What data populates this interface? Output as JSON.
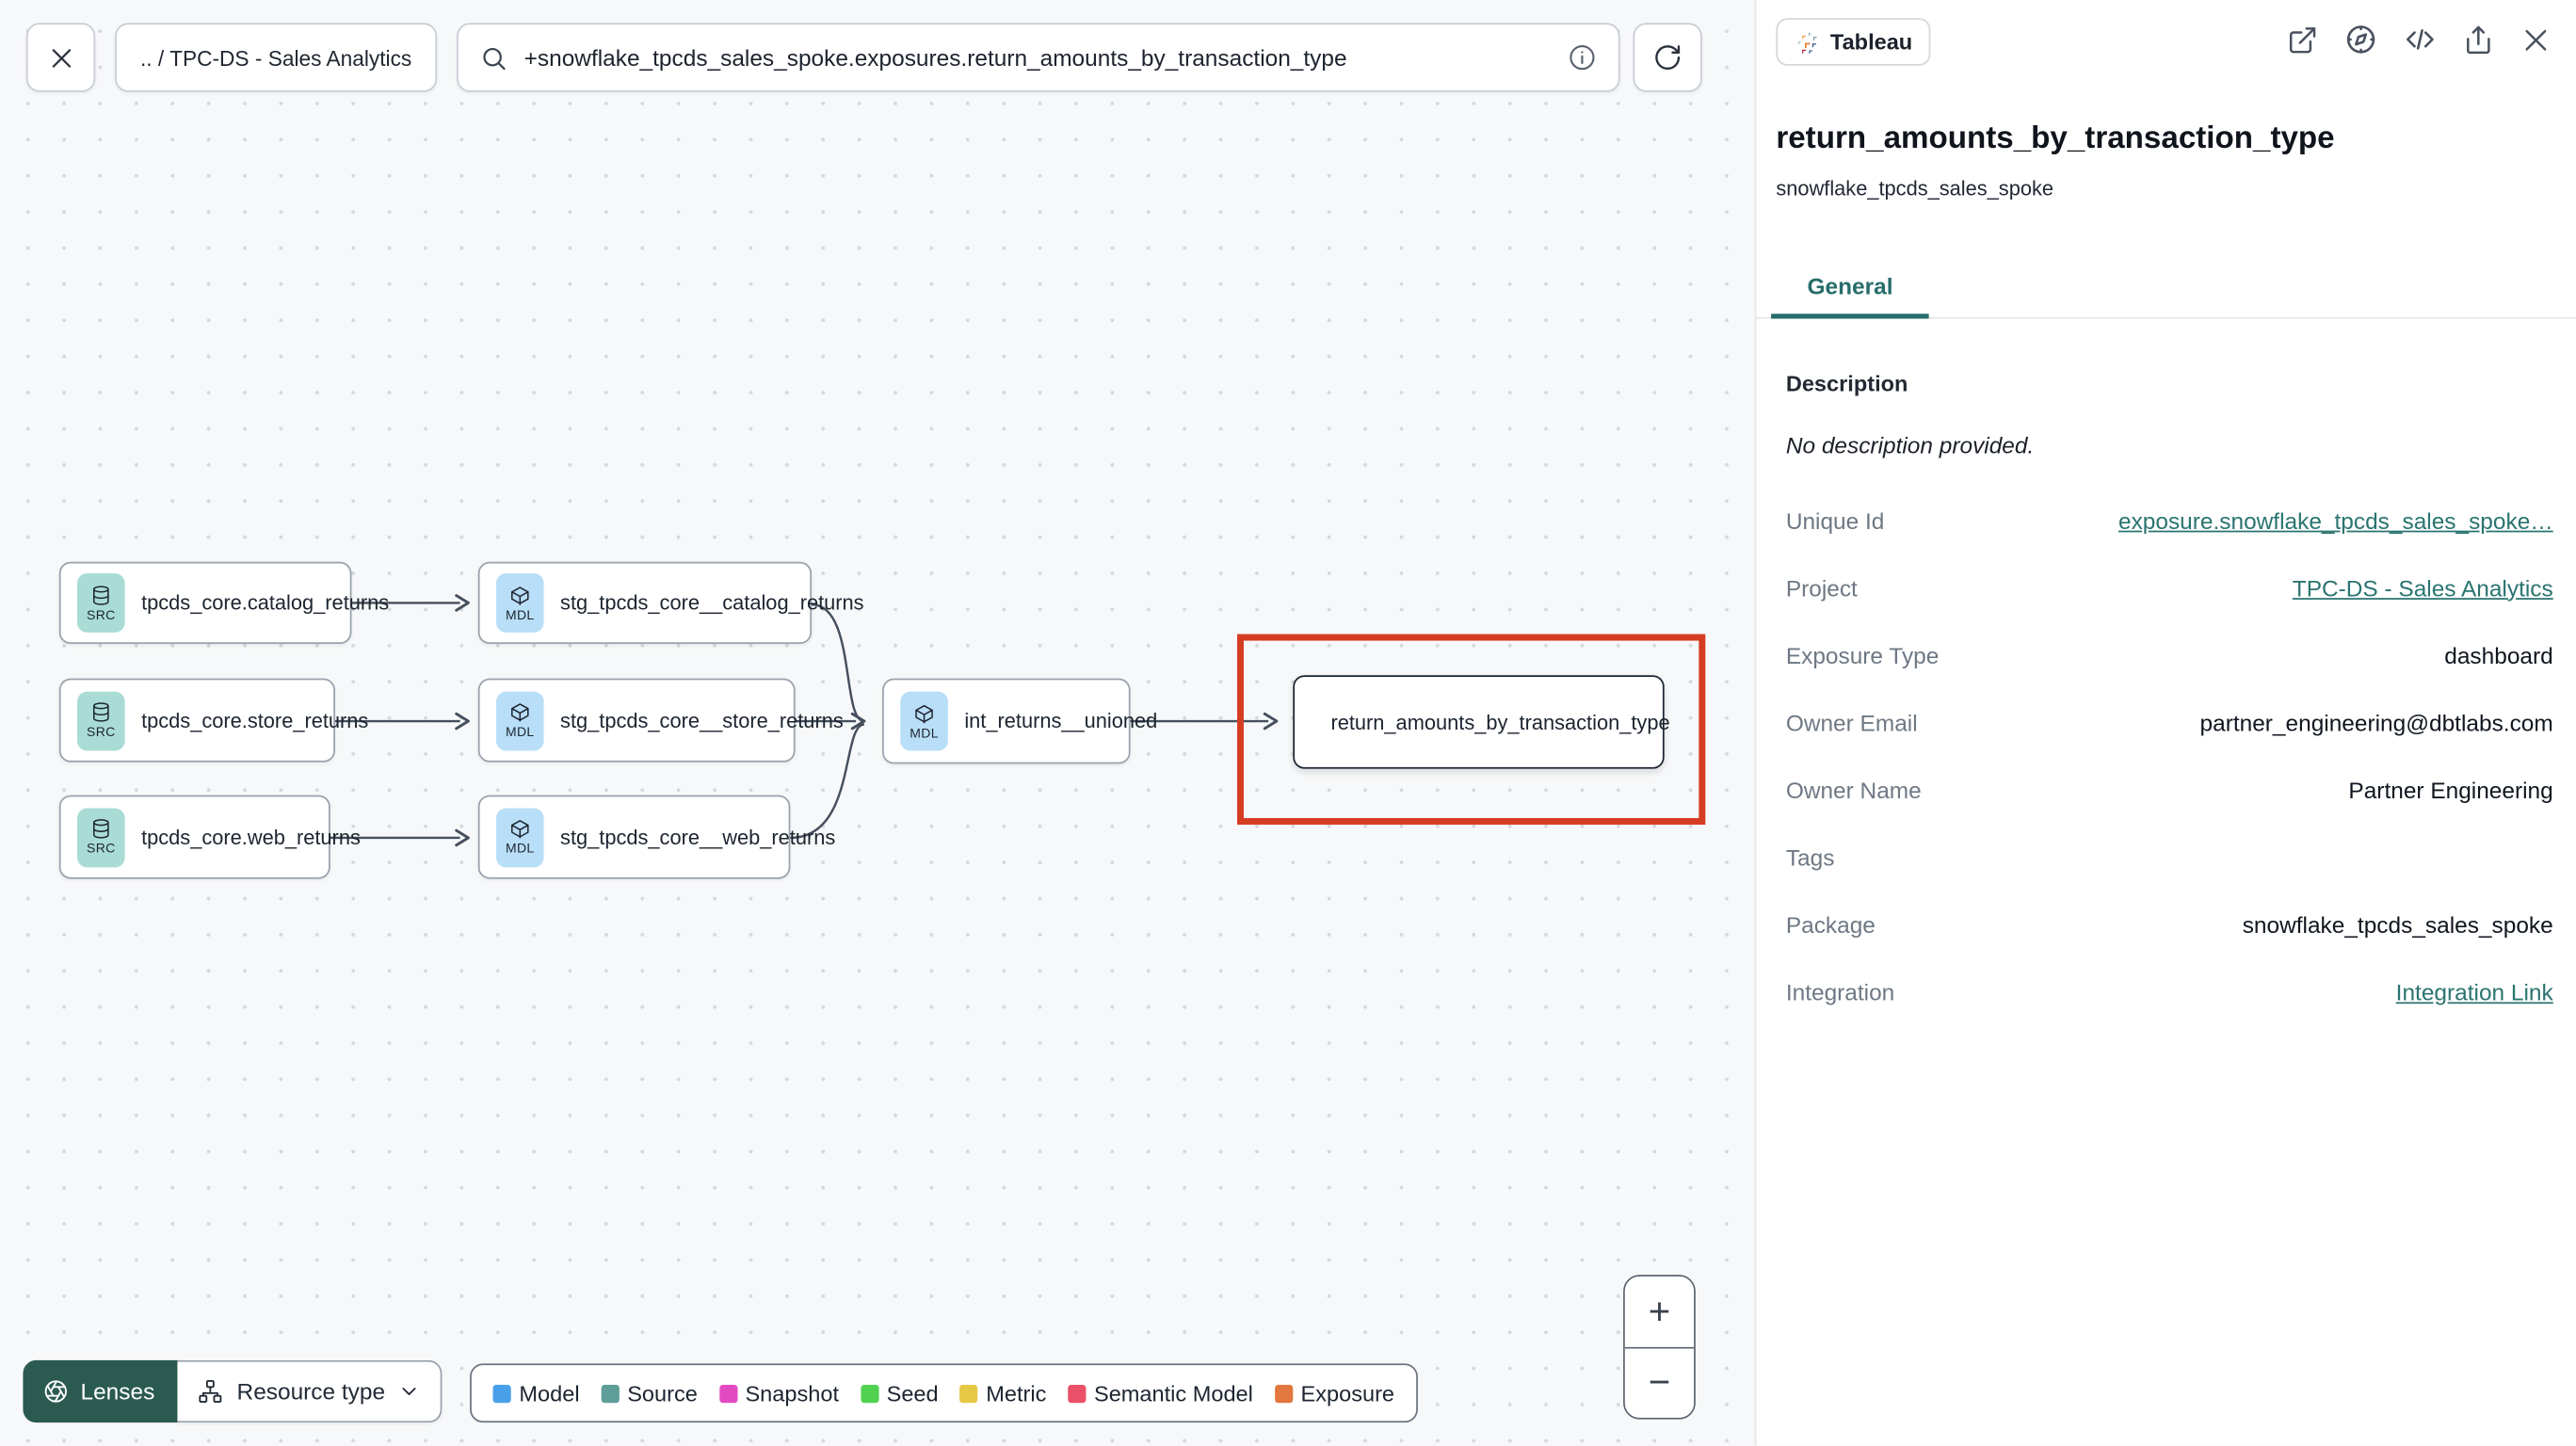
{
  "header": {
    "breadcrumb": ".. / TPC-DS - Sales Analytics",
    "search_value": "+snowflake_tpcds_sales_spoke.exposures.return_amounts_by_transaction_type"
  },
  "graph": {
    "nodes": [
      {
        "type": "SRC",
        "label": "tpcds_core.catalog_returns"
      },
      {
        "type": "MDL",
        "label": "stg_tpcds_core__catalog_returns"
      },
      {
        "type": "SRC",
        "label": "tpcds_core.store_returns"
      },
      {
        "type": "MDL",
        "label": "stg_tpcds_core__store_returns"
      },
      {
        "type": "SRC",
        "label": "tpcds_core.web_returns"
      },
      {
        "type": "MDL",
        "label": "stg_tpcds_core__web_returns"
      },
      {
        "type": "MDL",
        "label": "int_returns__unioned"
      },
      {
        "type": "exposure",
        "label": "return_amounts_by_transaction_type",
        "selected": true
      }
    ]
  },
  "toolbar": {
    "lenses_label": "Lenses",
    "resource_type_label": "Resource type",
    "legend": [
      {
        "label": "Model",
        "color": "#49a0e8"
      },
      {
        "label": "Source",
        "color": "#5e9d98"
      },
      {
        "label": "Snapshot",
        "color": "#e24ac1"
      },
      {
        "label": "Seed",
        "color": "#50d250"
      },
      {
        "label": "Metric",
        "color": "#e6c844"
      },
      {
        "label": "Semantic Model",
        "color": "#ea5168"
      },
      {
        "label": "Exposure",
        "color": "#e2773f"
      }
    ]
  },
  "zoom_controls": {
    "zoom_in": "+",
    "zoom_out": "−"
  },
  "panel": {
    "badge_label": "Tableau",
    "title": "return_amounts_by_transaction_type",
    "subtitle": "snowflake_tpcds_sales_spoke",
    "tab_general": "General",
    "description_label": "Description",
    "description_value": "No description provided.",
    "fields": [
      {
        "label": "Unique Id",
        "value": "exposure.snowflake_tpcds_sales_spoke…",
        "link": true
      },
      {
        "label": "Project",
        "value": "TPC-DS - Sales Analytics",
        "link": true
      },
      {
        "label": "Exposure Type",
        "value": "dashboard",
        "link": false
      },
      {
        "label": "Owner Email",
        "value": "partner_engineering@dbtlabs.com",
        "link": false
      },
      {
        "label": "Owner Name",
        "value": "Partner Engineering",
        "link": false
      },
      {
        "label": "Tags",
        "value": "",
        "link": false
      },
      {
        "label": "Package",
        "value": "snowflake_tpcds_sales_spoke",
        "link": false
      },
      {
        "label": "Integration",
        "value": "Integration Link",
        "link": true
      }
    ]
  },
  "colors": {
    "accent_teal": "#266d6a",
    "highlight_red": "#d63c21",
    "src_badge": "#a9dcd5",
    "mdl_badge": "#b9def7",
    "lenses_green": "#2b5a51"
  }
}
